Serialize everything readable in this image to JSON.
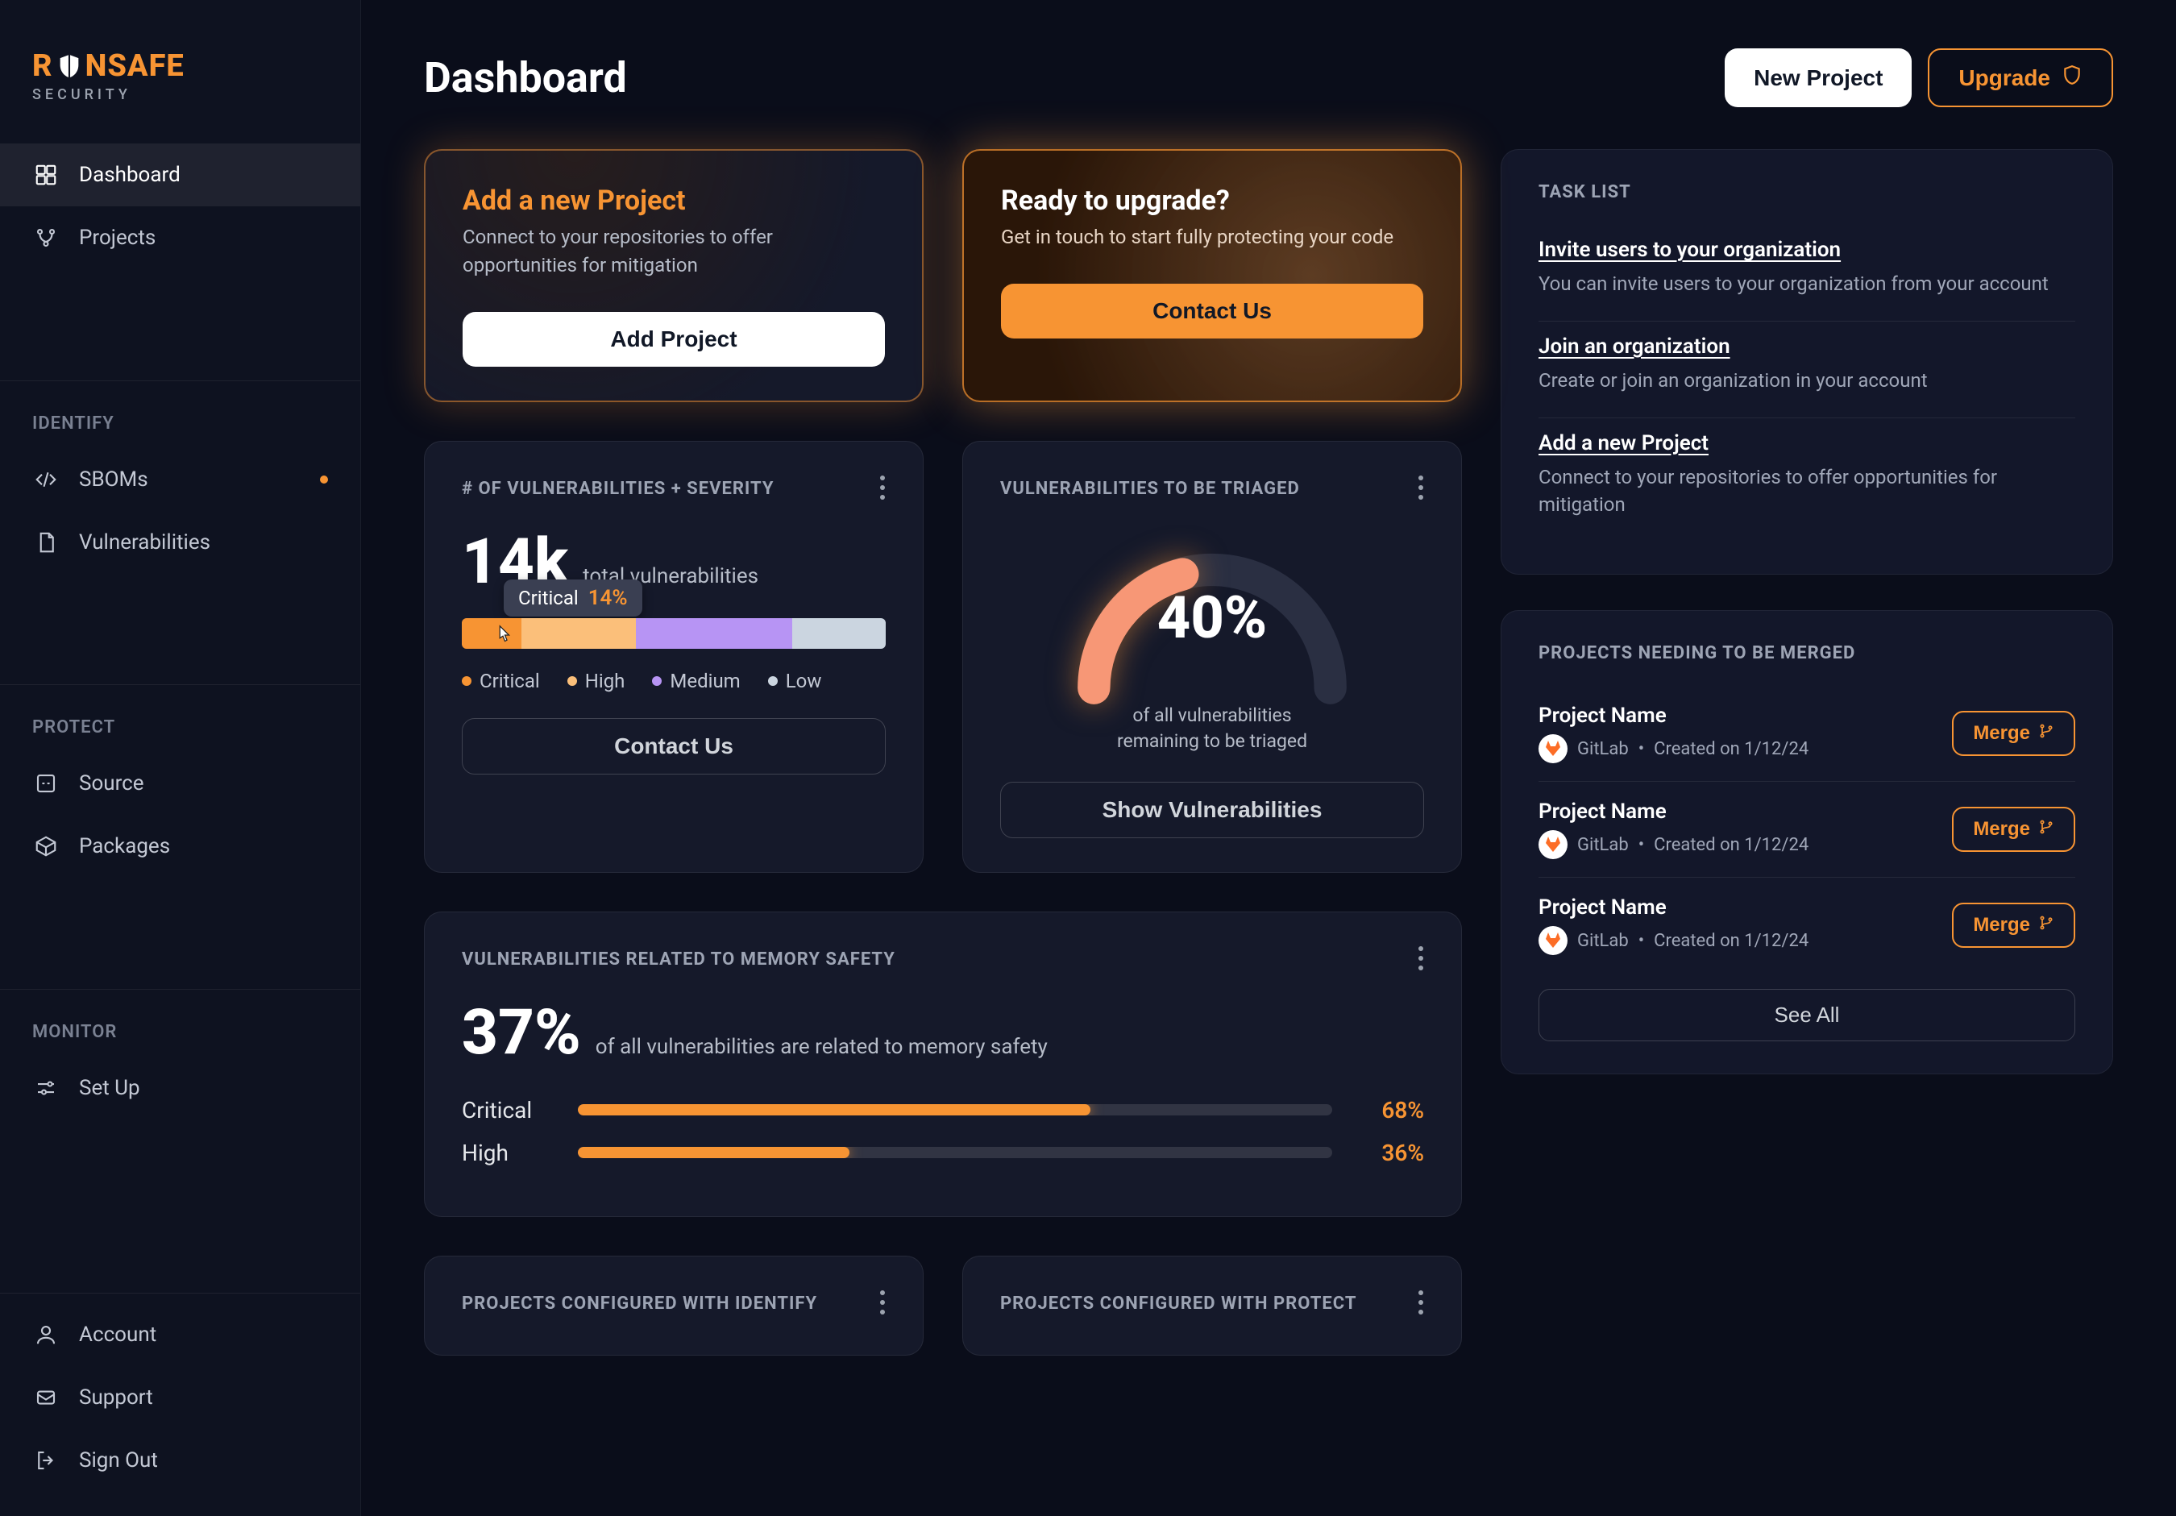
{
  "brand": {
    "word_a": "R",
    "word_b": "NSAFE",
    "sub": "SECURITY"
  },
  "nav": {
    "primary": [
      {
        "label": "Dashboard",
        "icon": "dashboard",
        "active": true
      },
      {
        "label": "Projects",
        "icon": "projects"
      }
    ],
    "sections": [
      {
        "label": "IDENTIFY",
        "items": [
          {
            "label": "SBOMs",
            "icon": "sboms",
            "dot": true
          },
          {
            "label": "Vulnerabilities",
            "icon": "vulns"
          }
        ]
      },
      {
        "label": "PROTECT",
        "items": [
          {
            "label": "Source",
            "icon": "source"
          },
          {
            "label": "Packages",
            "icon": "packages"
          }
        ]
      },
      {
        "label": "MONITOR",
        "items": [
          {
            "label": "Set Up",
            "icon": "setup"
          }
        ]
      }
    ],
    "footer": [
      {
        "label": "Account",
        "icon": "account"
      },
      {
        "label": "Support",
        "icon": "support"
      },
      {
        "label": "Sign Out",
        "icon": "signout"
      }
    ]
  },
  "header": {
    "title": "Dashboard",
    "new_project": "New Project",
    "upgrade": "Upgrade"
  },
  "cta_add": {
    "title": "Add a new Project",
    "desc": "Connect to your repositories to offer opportunities for mitigation",
    "button": "Add Project"
  },
  "cta_upgrade": {
    "title": "Ready to upgrade?",
    "desc": "Get in touch to start fully protecting your code",
    "button": "Contact Us"
  },
  "vuln_card": {
    "label": "# OF VULNERABILITIES + SEVERITY",
    "total": "14k",
    "total_label": "total vulnerabilities",
    "tooltip_label": "Critical",
    "tooltip_value": "14%",
    "contact": "Contact Us",
    "legend": {
      "critical": "Critical",
      "high": "High",
      "medium": "Medium",
      "low": "Low"
    }
  },
  "triage_card": {
    "label": "VULNERABILITIES TO BE TRIAGED",
    "value": "40%",
    "sub1": "of all vulnerabilities",
    "sub2": "remaining to be triaged",
    "button": "Show Vulnerabilities"
  },
  "mem_card": {
    "label": "VULNERABILITIES RELATED TO MEMORY SAFETY",
    "value": "37%",
    "value_label": "of all vulnerabilities are related to memory safety",
    "rows": [
      {
        "label": "Critical",
        "pct": "68%"
      },
      {
        "label": "High",
        "pct": "36%"
      }
    ]
  },
  "bottom_cards": {
    "identify": "PROJECTS CONFIGURED WITH IDENTIFY",
    "protect": "PROJECTS CONFIGURED WITH PROTECT"
  },
  "task_list": {
    "label": "TASK LIST",
    "items": [
      {
        "title": "Invite users to your organization",
        "desc": "You can invite users to your organization from your account"
      },
      {
        "title": "Join an organization",
        "desc": "Create or join an organization in your account"
      },
      {
        "title": "Add a new Project",
        "desc": "Connect to your repositories to offer opportunities for mitigation"
      }
    ]
  },
  "merge_list": {
    "label": "PROJECTS NEEDING TO BE MERGED",
    "items": [
      {
        "name": "Project Name",
        "source": "GitLab",
        "created": "Created on 1/12/24"
      },
      {
        "name": "Project Name",
        "source": "GitLab",
        "created": "Created on 1/12/24"
      },
      {
        "name": "Project Name",
        "source": "GitLab",
        "created": "Created on 1/12/24"
      }
    ],
    "button": "Merge",
    "see_all": "See All"
  },
  "colors": {
    "critical": "#f79433",
    "high": "#fbbf7a",
    "medium": "#b794f4",
    "low": "#cbd5e0"
  },
  "chart_data": [
    {
      "type": "bar",
      "id": "severity-distribution",
      "title": "# OF VULNERABILITIES + SEVERITY",
      "total_label": "14k total vulnerabilities",
      "categories": [
        "Critical",
        "High",
        "Medium",
        "Low"
      ],
      "values_pct": [
        14,
        27,
        37,
        22
      ],
      "annotation": "Critical 14%",
      "colors": [
        "#f79433",
        "#fbbf7a",
        "#b794f4",
        "#cbd5e0"
      ]
    },
    {
      "type": "pie",
      "id": "triage-gauge",
      "title": "VULNERABILITIES TO BE TRIAGED",
      "semi_circle": true,
      "series": [
        {
          "name": "remaining",
          "value": 40
        },
        {
          "name": "triaged",
          "value": 60
        }
      ],
      "center_label": "40%"
    },
    {
      "type": "bar",
      "id": "memory-safety",
      "title": "VULNERABILITIES RELATED TO MEMORY SAFETY",
      "subtitle": "37% of all vulnerabilities are related to memory safety",
      "orientation": "horizontal",
      "categories": [
        "Critical",
        "High"
      ],
      "values_pct": [
        68,
        36
      ],
      "xlim": [
        0,
        100
      ]
    }
  ]
}
